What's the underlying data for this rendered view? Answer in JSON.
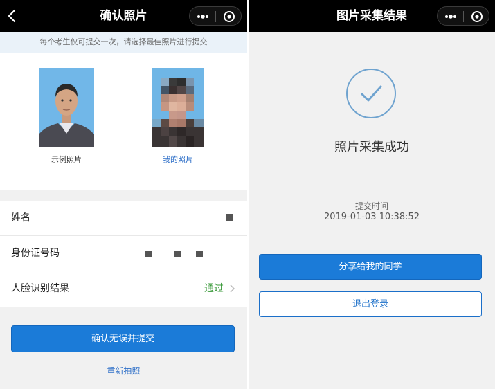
{
  "left": {
    "title": "确认照片",
    "notice": "每个考生仅可提交一次，请选择最佳照片进行提交",
    "photos": {
      "sample_label": "示例照片",
      "mine_label": "我的照片"
    },
    "info": {
      "name_label": "姓名",
      "id_label": "身份证号码",
      "face_label": "人脸识别结果",
      "face_value": "通过"
    },
    "confirm_button": "确认无误并提交",
    "retake_link": "重新拍照"
  },
  "right": {
    "title": "图片采集结果",
    "success_text": "照片采集成功",
    "submit_time_label": "提交时间",
    "submit_time": "2019-01-03 10:38:52",
    "share_button": "分享给我的同学",
    "logout_button": "退出登录"
  },
  "colors": {
    "accent": "#1b7bd8",
    "success": "#3a9a3a",
    "check_ring": "#6fa3cf",
    "nav_bg": "#000000"
  },
  "icons": [
    "back-icon",
    "more-icon",
    "target-icon",
    "chevron-right-icon",
    "check-circle-icon"
  ]
}
